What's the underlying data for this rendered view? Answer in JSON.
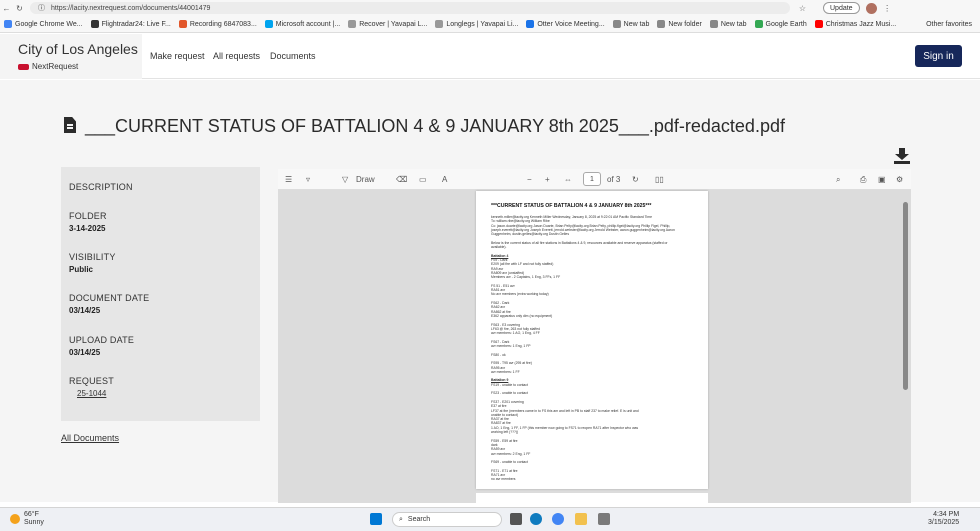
{
  "browser": {
    "url": "https://lacity.nextrequest.com/documents/44001479",
    "update_label": "Update",
    "bookmarks": [
      {
        "label": "Google Chrome We...",
        "color": "#4285f4"
      },
      {
        "label": "Flightradar24: Live F...",
        "color": "#333333"
      },
      {
        "label": "Recording 6847083...",
        "color": "#e2572b"
      },
      {
        "label": "Microsoft account |...",
        "color": "#00a4ef"
      },
      {
        "label": "Recover | Yavapai L...",
        "color": "#999999"
      },
      {
        "label": "Longlegs | Yavapai Li...",
        "color": "#999999"
      },
      {
        "label": "Otter Voice Meeting...",
        "color": "#1a73e8"
      },
      {
        "label": "New tab",
        "color": "#888888"
      },
      {
        "label": "New folder",
        "color": "#888888"
      },
      {
        "label": "New tab",
        "color": "#888888"
      },
      {
        "label": "Google Earth",
        "color": "#34a853"
      },
      {
        "label": "Christmas Jazz Musi...",
        "color": "#ff0000"
      }
    ],
    "other_favorites": "Other favorites"
  },
  "header": {
    "city": "City of Los Angeles",
    "product": "NextRequest",
    "nav": [
      "Make request",
      "All requests",
      "Documents"
    ],
    "signin": "Sign in"
  },
  "document": {
    "title": "___CURRENT STATUS OF BATTALION 4 & 9 JANUARY 8th 2025___.pdf-redacted.pdf"
  },
  "sidebar": {
    "description_label": "DESCRIPTION",
    "folder_label": "FOLDER",
    "folder_value": "3-14-2025",
    "visibility_label": "VISIBILITY",
    "visibility_value": "Public",
    "document_date_label": "DOCUMENT DATE",
    "document_date_value": "03/14/25",
    "upload_date_label": "UPLOAD DATE",
    "upload_date_value": "03/14/25",
    "request_label": "REQUEST",
    "request_value": "25-1044"
  },
  "all_documents": "All Documents",
  "viewer": {
    "draw_label": "Draw",
    "page_current": "1",
    "page_total": "of 3",
    "zoom_minus": "−",
    "zoom_plus": "+"
  },
  "pdf": {
    "title": "***CURRENT STATUS OF BATTALION 4 & 9 JANUARY 8th 2025***",
    "lines": [
      "kenneth.miller@lacity.org Kenneth Miller                     Wednesday, January 8, 2025 at 9:22:01 AM Pacific Standard Time",
      "To: william.ribe@lacity.org William Ribe",
      "Cc: jason.duarte@lacity.org Jason Duarte, Brian Pelty@lacity.org Brian Pelty, phillip.flgel@lacity.org Phillip Flgel, Phillip,",
      "joseph.everett@lacity.org Joseph Everett, jerrold.webster@lacity.org Jerrold Webster, aaron.guggenheim@lacity.org Aaron",
      "Guggenheim, dustin.gelles@lacity.org Dustin Gelles",
      "",
      "Below is the current status of all fire stations in Battalions 4 & 9, resources available and reserve apparatus (staffed or",
      "available).",
      "",
      "Battalion 4",
      "FS9 - Dark",
      "        E209 (all fire with LF and not fully staffed)",
      "        RA9 avr",
      "        RA809 avr (unstaffed)",
      "        Members avr - 2 Captains, 1 Eng, 3 FFs, 1 FF",
      "",
      "FS 51 - E51 avr",
      "        RA51 avr",
      "        No avr members (extra working today)",
      "",
      "FS62 - Dark",
      "        RA62 avr",
      "        RA862 at fire",
      "        E362 apparatus only dim (no equipment)",
      "",
      "FS63 - E3 covering",
      "        LF63 @ fire, 263 not fully staffed",
      "        avr members: 1 AO, 1 Eng, 4 FF",
      "",
      "FS67 - Dark",
      "        avr members: 1 Eng, 1 FP",
      "",
      "FS80 - ok",
      "",
      "FS95 - T95 avr (295 at fire)",
      "        RA95 avr",
      "        avr members: 1 FF",
      "",
      "Battalion 9",
      "FS19 - unable to contact",
      "",
      "FS23 - unable to contact",
      "",
      "FS37 - E201 covering",
      "        E37 at fire",
      "        LF37 at fire (members came in to FS this am and left in PB to staff 237          to make relief. E is unit and",
      "unable to contact)",
      "        RA37 at fire",
      "        RA837 at fire",
      "        1 AO, 1 Eng, 1 FF, 1 FP (this member now going to FS71 to reopen                   RA71 after Inspector who was",
      "working left (???))",
      "",
      "FS59 - E59 at fire",
      "        dark",
      "        RA59 avr",
      "        avr members: 2 Eng, 1 FF",
      "",
      "FS69 - unable to contact",
      "",
      "FS71 - E71 at fire",
      "        RA71 avr",
      "        no avr members"
    ]
  },
  "taskbar": {
    "temp": "66°F",
    "condition": "Sunny",
    "search_placeholder": "Search",
    "time": "4:34 PM",
    "date": "3/15/2025"
  }
}
